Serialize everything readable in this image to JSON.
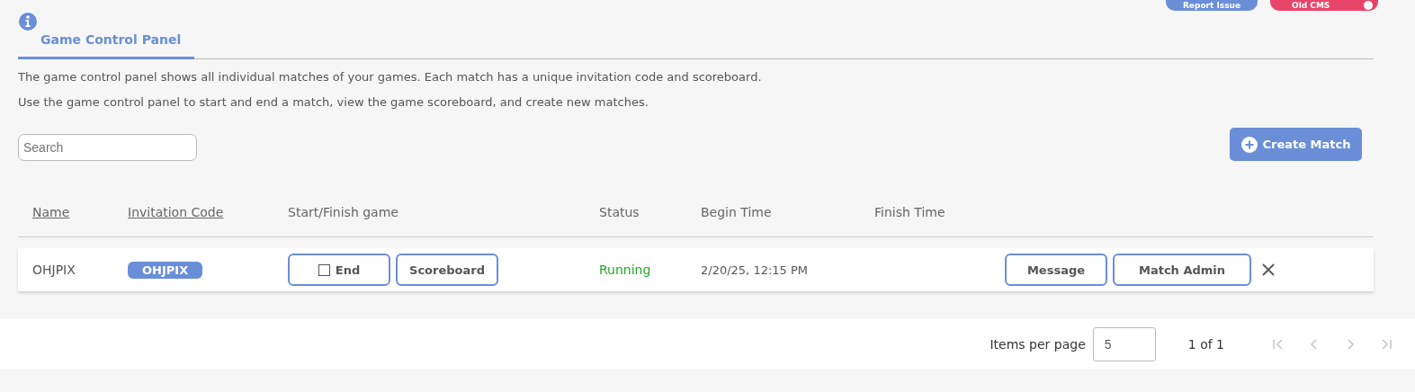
{
  "top_buttons": [
    {
      "label": "Report Issue",
      "kind": "button"
    },
    {
      "label": "Old CMS",
      "kind": "toggle",
      "on": true
    }
  ],
  "tabs": [
    {
      "label": "Game Control Panel",
      "selected": true
    }
  ],
  "description": [
    "The game control panel shows all individual matches of your games. Each match has a unique invitation code and scoreboard.",
    "Use the game control panel to start and end a match, view the game scoreboard, and create new matches."
  ],
  "search": {
    "placeholder": "Search"
  },
  "create_button": "Create Match",
  "table": {
    "columns": [
      {
        "label": "Name",
        "sortable": true
      },
      {
        "label": "Invitation Code",
        "sortable": true
      },
      {
        "label": "Start/Finish game",
        "sortable": false
      },
      {
        "label": "Status",
        "sortable": false
      },
      {
        "label": "Begin Time",
        "sortable": false
      },
      {
        "label": "Finish Time",
        "sortable": false
      }
    ],
    "rows": [
      {
        "name": "OHJPIX",
        "code": "OHJPIX",
        "end_button": "End",
        "scoreboard_button": "Scoreboard",
        "status": "Running",
        "begin_time": "2/20/25, 12:15 PM",
        "finish_time": "",
        "actions": [
          "Message",
          "Match Admin"
        ]
      }
    ]
  },
  "pagination": {
    "items_per_page_label": "Items per page",
    "items_per_page": "5",
    "range": "1 of 1",
    "first_disabled": true,
    "previous_disabled": true,
    "next_disabled": true,
    "last_disabled": true
  }
}
